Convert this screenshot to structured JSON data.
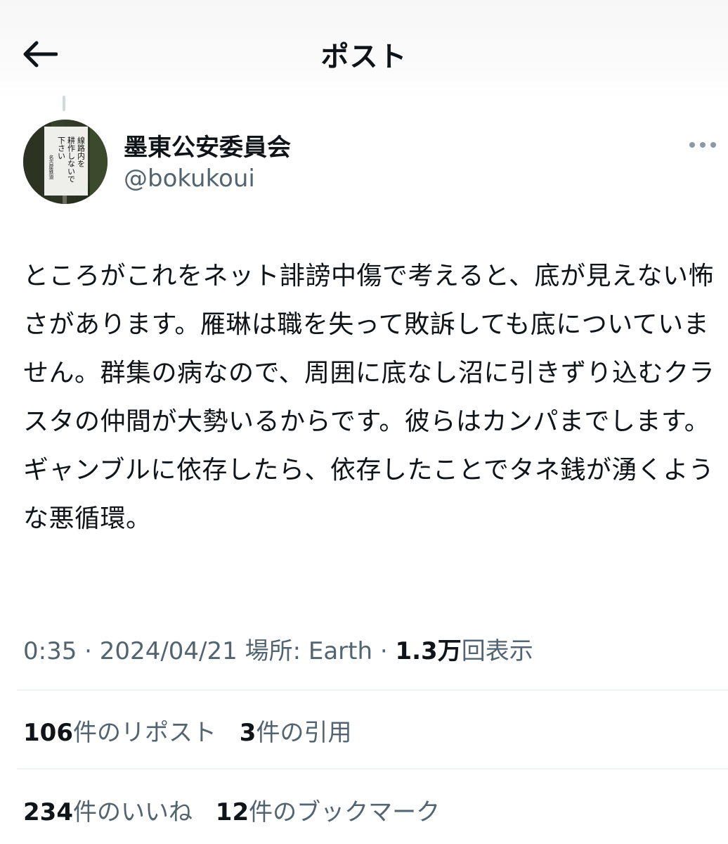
{
  "header": {
    "title": "ポスト",
    "back_icon": "arrow-left-icon"
  },
  "author": {
    "display_name": "墨東公安委員会",
    "handle": "@bokukoui",
    "avatar_icon": "avatar-sign-photo",
    "avatar_sign_text": [
      "線路内を",
      "耕作しないで",
      "下さい",
      "名古屋鉄道"
    ],
    "more_icon": "more-horizontal-icon"
  },
  "post": {
    "text": "ところがこれをネット誹謗中傷で考えると、底が見えない怖さがあります。雁琳は職を失って敗訴しても底についていません。群集の病なので、周囲に底なし沼に引きずり込むクラスタの仲間が大勢いるからです。彼らはカンパまでします。ギャンブルに依存したら、依存したことでタネ銭が湧くような悪循環。"
  },
  "meta": {
    "time": "0:35",
    "sep1": "·",
    "date": "2024/04/21",
    "location": "場所: Earth",
    "sep2": "·",
    "views_count": "1.3万",
    "views_label": "回表示"
  },
  "stats": {
    "reposts_count": "106",
    "reposts_label": "件のリポスト",
    "quotes_count": "3",
    "quotes_label": "件の引用",
    "likes_count": "234",
    "likes_label": "件のいいね",
    "bookmarks_count": "12",
    "bookmarks_label": "件のブックマーク"
  },
  "colors": {
    "text_primary": "#0f1419",
    "text_secondary": "#536471",
    "divider": "#eff3f4"
  }
}
